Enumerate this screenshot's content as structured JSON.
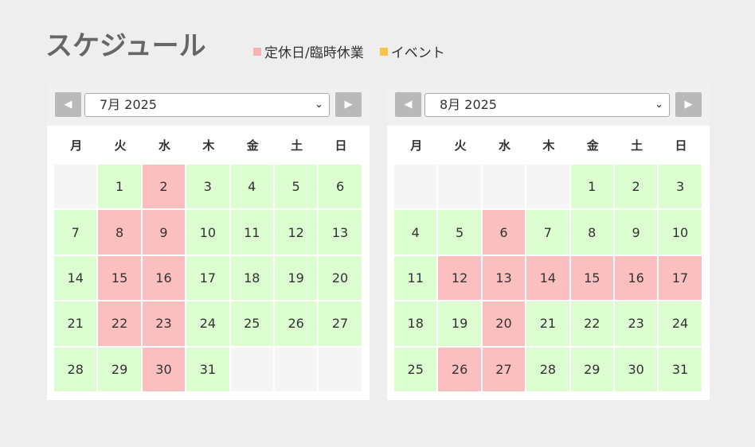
{
  "title": "スケジュール",
  "legend": [
    {
      "label": "定休日/臨時休業",
      "color": "#f6b3b3"
    },
    {
      "label": "イベント",
      "color": "#f7c34a"
    }
  ],
  "colors": {
    "open": "#dcfdd0",
    "closed": "#fbbfbf",
    "empty": "#f5f5f5"
  },
  "weekdays": [
    "月",
    "火",
    "水",
    "木",
    "金",
    "土",
    "日"
  ],
  "calendars": [
    {
      "month_label": "7月 2025",
      "prev_icon": "left-triangle-icon",
      "next_icon": "right-triangle-icon",
      "leading_blanks": 1,
      "days": 31,
      "closed_days": [
        2,
        8,
        9,
        15,
        16,
        22,
        23,
        30
      ]
    },
    {
      "month_label": "8月 2025",
      "prev_icon": "left-triangle-icon",
      "next_icon": "right-triangle-icon",
      "leading_blanks": 4,
      "days": 31,
      "closed_days": [
        6,
        12,
        13,
        14,
        15,
        16,
        17,
        20,
        26,
        27
      ]
    }
  ]
}
